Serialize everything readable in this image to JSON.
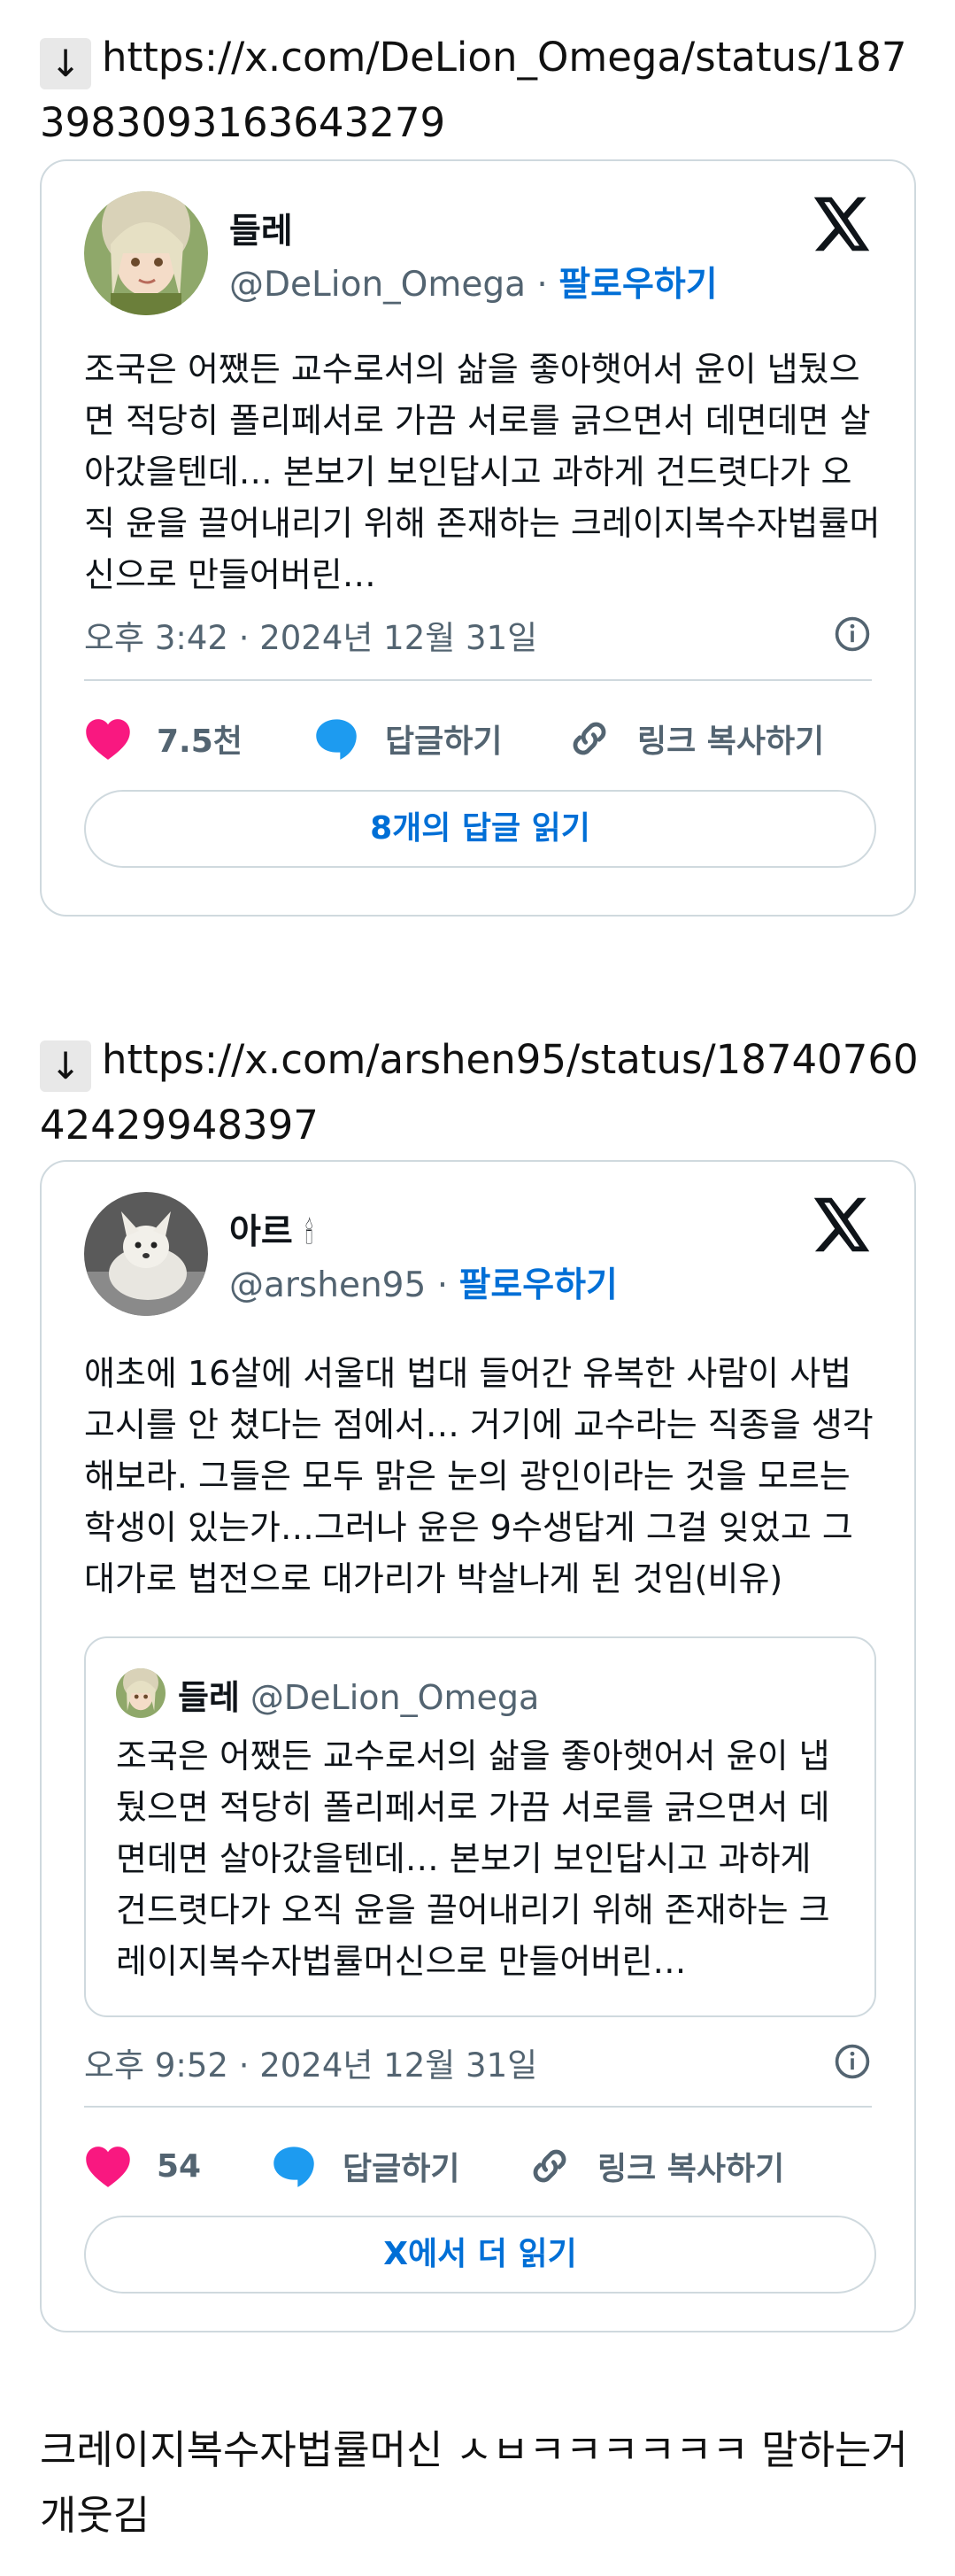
{
  "links": [
    {
      "arrow": "↓",
      "url": "https://x.com/DeLion_Omega/status/1873983093163643279"
    },
    {
      "arrow": "↓",
      "url": "https://x.com/arshen95/status/1874076042429948397"
    }
  ],
  "tweet1": {
    "name": "들레",
    "handle": "@DeLion_Omega",
    "separator": "·",
    "follow": "팔로우하기",
    "text": "조국은 어쨌든 교수로서의 삶을 좋아햇어서 윤이 냅뒀으면 적당히 폴리페서로 가끔 서로를 긁으면서 데면데면 살아갔을텐데… 본보기 보인답시고 과하게 건드렷다가 오직 윤을 끌어내리기 위해 존재하는 크레이지복수자법률머신으로 만들어버린…",
    "timestamp": "오후 3:42 · 2024년 12월 31일",
    "likes": "7.5천",
    "reply": "답글하기",
    "copy_link": "링크 복사하기",
    "read_more": "8개의 답글 읽기"
  },
  "tweet2": {
    "name": "아르",
    "name_emoji": "🕯",
    "handle": "@arshen95",
    "separator": "·",
    "follow": "팔로우하기",
    "text": "애초에 16살에 서울대 법대 들어간 유복한 사람이 사법고시를 안 쳤다는 점에서… 거기에 교수라는 직종을 생각해보라. 그들은 모두 맑은 눈의 광인이라는 것을 모르는 학생이 있는가…그러나 윤은 9수생답게 그걸 잊었고 그 대가로 법전으로 대가리가 박살나게 된 것임(비유)",
    "quote": {
      "name": "들레",
      "handle": "@DeLion_Omega",
      "text": "조국은 어쨌든 교수로서의 삶을 좋아햇어서 윤이 냅뒀으면 적당히 폴리페서로 가끔 서로를 긁으면서 데면데면 살아갔을텐데… 본보기 보인답시고 과하게 건드렷다가 오직 윤을 끌어내리기 위해 존재하는 크레이지복수자법률머신으로 만들어버린…"
    },
    "timestamp": "오후 9:52 · 2024년 12월 31일",
    "likes": "54",
    "reply": "답글하기",
    "copy_link": "링크 복사하기",
    "read_more": "X에서 더 읽기"
  },
  "comment": "크레이지복수자법률머신 ㅅㅂㅋㅋㅋㅋㅋㅋ 말하는거 개웃김",
  "colors": {
    "heart": "#f91880",
    "bubble": "#1d9bf0",
    "link_blue": "#006fd6",
    "border": "#cfd9de",
    "secondary": "#536471"
  }
}
